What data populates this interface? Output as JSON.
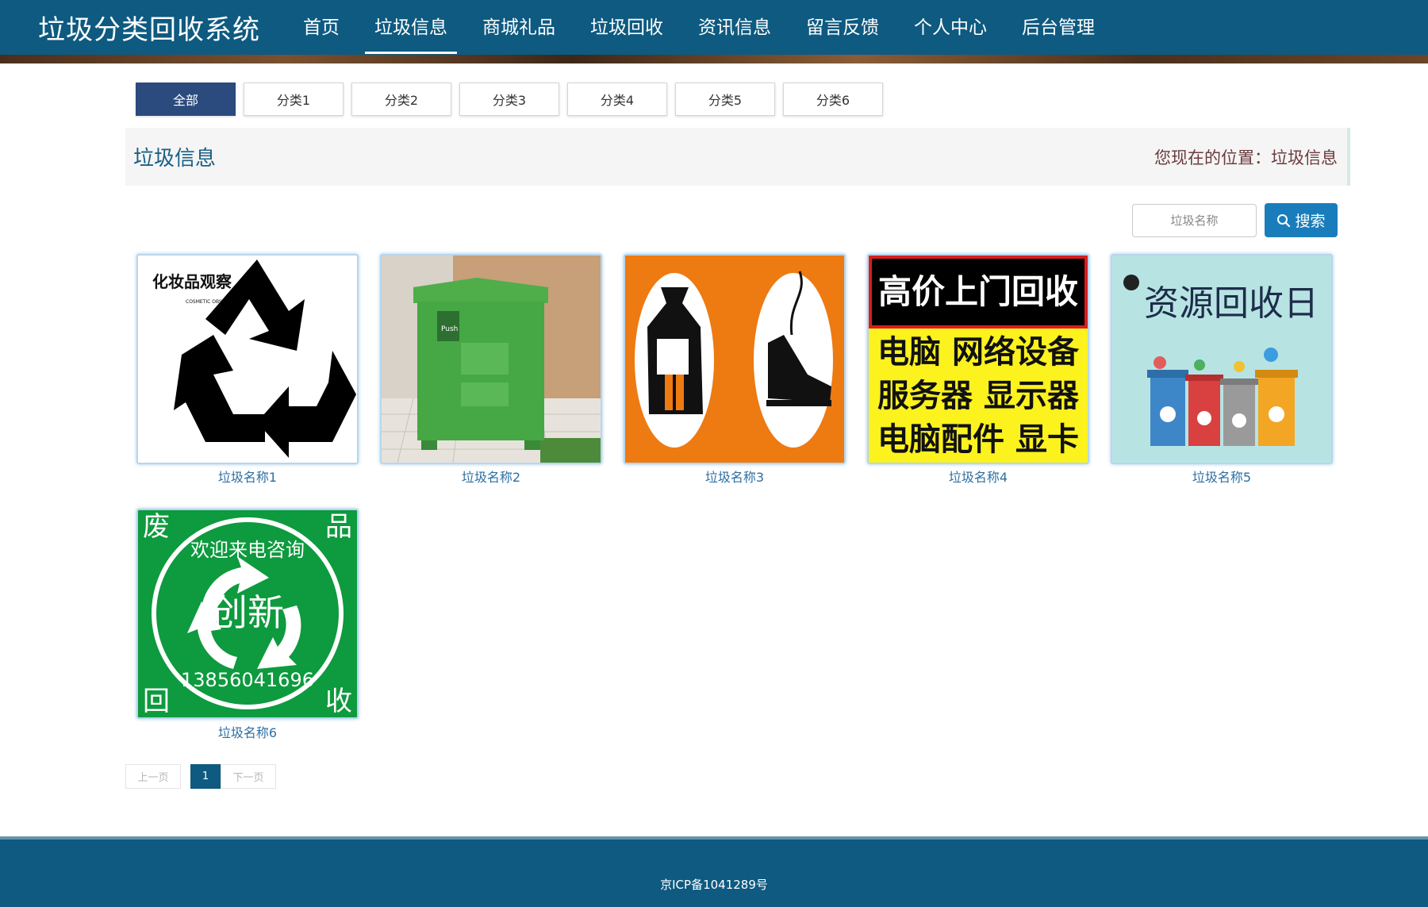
{
  "brand": "垃圾分类回收系统",
  "nav": [
    "首页",
    "垃圾信息",
    "商城礼品",
    "垃圾回收",
    "资讯信息",
    "留言反馈",
    "个人中心",
    "后台管理"
  ],
  "categories": [
    "全部",
    "分类1",
    "分类2",
    "分类3",
    "分类4",
    "分类5",
    "分类6"
  ],
  "page_title": "垃圾信息",
  "breadcrumb": "您现在的位置：垃圾信息",
  "search": {
    "placeholder": "垃圾名称",
    "button": "搜索"
  },
  "items": [
    {
      "name": "垃圾名称1",
      "art": {
        "brand": "化妆品观察",
        "brand_en": "COSMETIC OBSERVER"
      }
    },
    {
      "name": "垃圾名称2",
      "art": {
        "label": "Push"
      }
    },
    {
      "name": "垃圾名称3"
    },
    {
      "name": "垃圾名称4",
      "art": {
        "line1": "高价上门回收",
        "line2": "电脑 网络设备",
        "line3": "服务器 显示器",
        "line4": "电脑配件 显卡"
      }
    },
    {
      "name": "垃圾名称5",
      "art": {
        "title": "资源回收日"
      }
    },
    {
      "name": "垃圾名称6",
      "art": {
        "tl": "废",
        "tr": "品",
        "bl": "回",
        "br": "收",
        "arc": "欢迎来电咨询",
        "center": "创新",
        "phone": "13856041696"
      }
    }
  ],
  "pager": {
    "prev": "上一页",
    "current": "1",
    "next": "下一页"
  },
  "footer": "京ICP备1041289号"
}
